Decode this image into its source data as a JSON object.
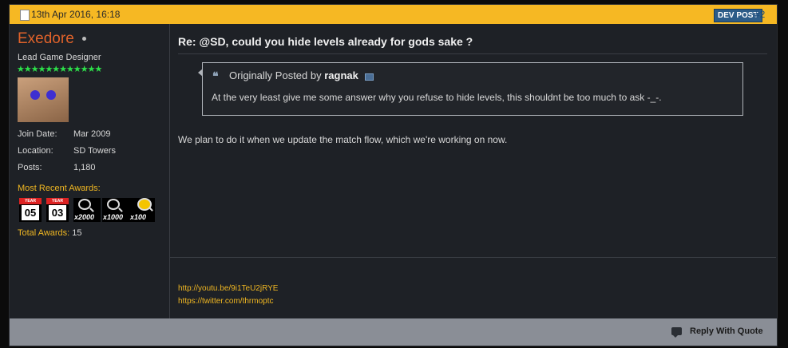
{
  "header": {
    "date": "13th Apr 2016, 16:18",
    "dev_badge": "DEV POST",
    "post_number": "#2"
  },
  "user": {
    "name": "Exedore",
    "title": "Lead Game Designer",
    "stars": "★★★★★★★★★★★★",
    "info": [
      {
        "label": "Join Date:",
        "value": "Mar 2009"
      },
      {
        "label": "Location:",
        "value": "SD Towers"
      },
      {
        "label": "Posts:",
        "value": "1,180"
      }
    ],
    "awards_label": "Most Recent Awards:",
    "awards": [
      {
        "header": "YEAR",
        "text": "05"
      },
      {
        "header": "YEAR",
        "text": "03"
      },
      {
        "text": "x2000"
      },
      {
        "text": "x1000"
      },
      {
        "text": "x100"
      }
    ],
    "total_awards_label": "Total Awards:",
    "total_awards_value": "15"
  },
  "post": {
    "title": "Re: @SD, could you hide levels already for gods sake ?",
    "quote": {
      "prefix": "Originally Posted by",
      "author": "ragnak",
      "text": "At the very least give me some answer why you refuse to hide levels, this shouldnt be too much to ask -_-."
    },
    "body": "We plan to do it when we update the match flow, which we're working on now."
  },
  "signature": {
    "links": [
      "http://youtu.be/9i1TeU2jRYE",
      "https://twitter.com/thrmoptc"
    ]
  },
  "footer": {
    "reply_with_quote": "Reply With Quote"
  },
  "colors": {
    "header_bar": "#f6b823",
    "username": "#e0622a",
    "accent_gold": "#f0b722",
    "dev_badge": "#2c5c88",
    "background": "#1e2126",
    "footer": "#8a8e96"
  }
}
